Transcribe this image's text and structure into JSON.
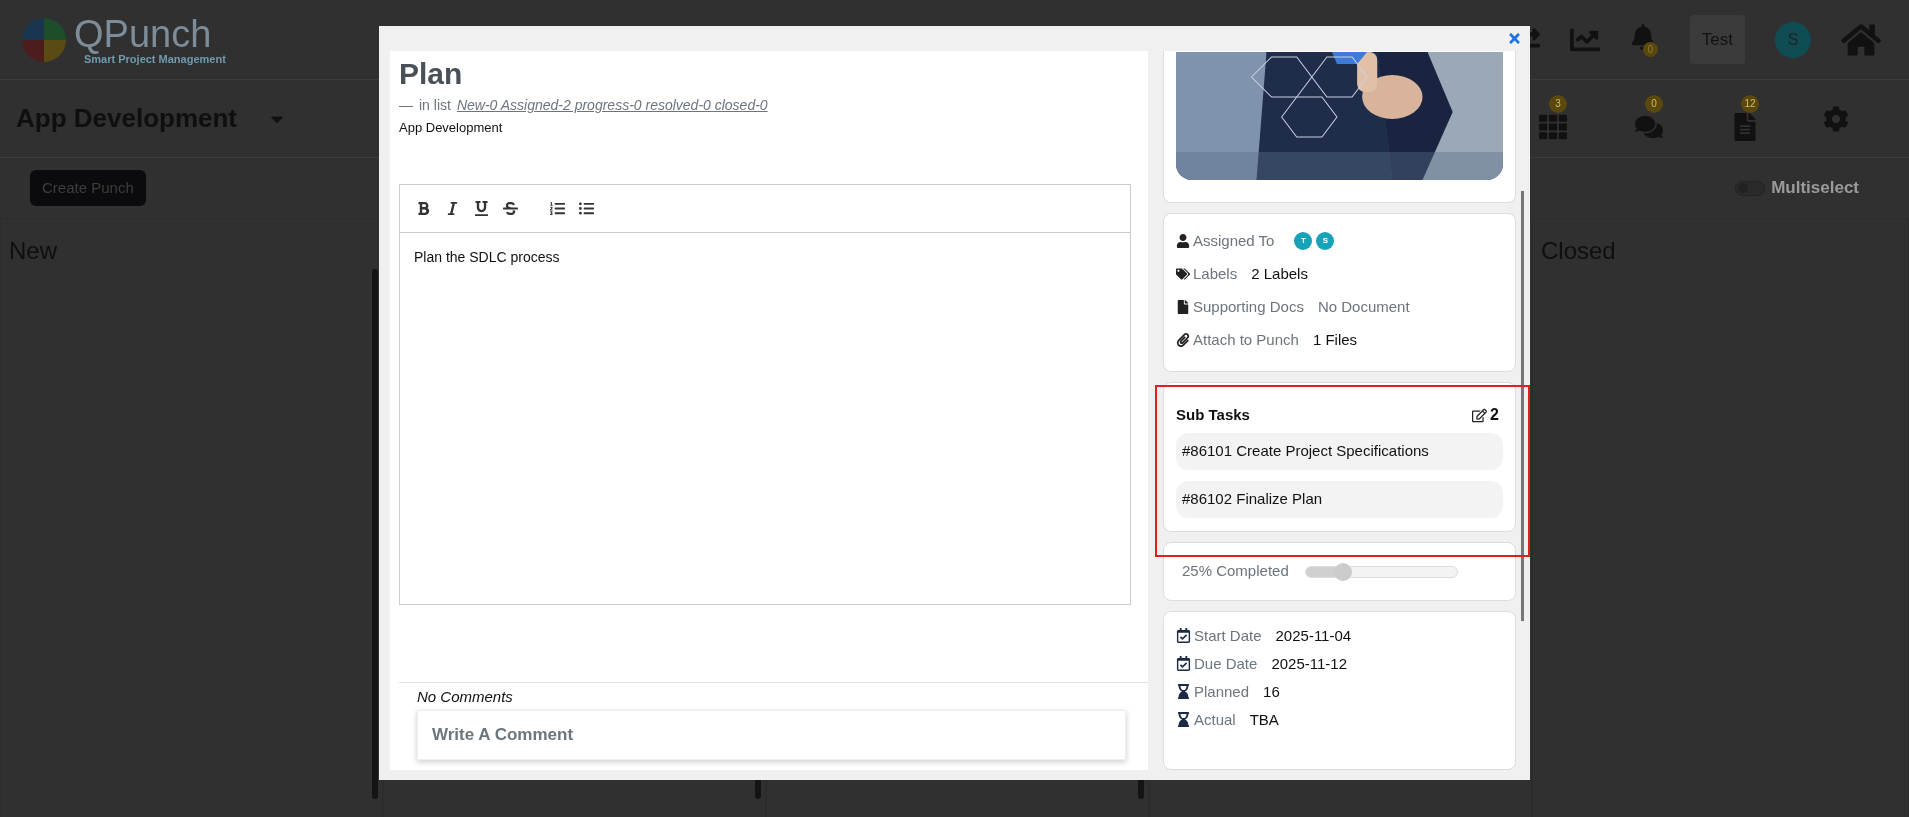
{
  "header": {
    "logo_title": "QPunch",
    "logo_subtitle": "Smart Project Management",
    "notification_count": "0",
    "user_label": "Test",
    "avatar": "S"
  },
  "project": {
    "name": "App Development",
    "badges": [
      {
        "kind": "grid",
        "count": "3"
      },
      {
        "kind": "chat",
        "count": "0"
      },
      {
        "kind": "document",
        "count": "12"
      }
    ]
  },
  "create_button": "Create Punch",
  "multiselect": {
    "label": "Multiselect",
    "on": false
  },
  "columns": [
    {
      "title": "New"
    },
    {
      "title": "Closed"
    }
  ],
  "modal": {
    "title": "Plan",
    "list_dash": "—",
    "list_prefix": "in list",
    "list_link": "New-0 Assigned-2 progress-0 resolved-0 closed-0",
    "project": "App Development",
    "editor": {
      "tools": [
        {
          "kind": "bold"
        },
        {
          "kind": "italic"
        },
        {
          "kind": "underline"
        },
        {
          "kind": "strike"
        },
        {
          "kind": "ordered-list"
        },
        {
          "kind": "bullet-list"
        }
      ],
      "content": "Plan the SDLC process"
    },
    "comments": {
      "empty_text": "No Comments",
      "placeholder": "Write A Comment"
    },
    "details": [
      {
        "kind": "assignees",
        "label": "Assigned To",
        "avatars": [
          "T",
          "S"
        ]
      },
      {
        "kind": "labels",
        "label": "Labels",
        "value": "2 Labels"
      },
      {
        "kind": "docs",
        "label": "Supporting Docs",
        "value": "No Document"
      },
      {
        "kind": "attachments",
        "label": "Attach to Punch",
        "value": "1 Files"
      }
    ],
    "subtasks": {
      "title": "Sub Tasks",
      "count": "2",
      "items": [
        "#86101 Create Project Specifications",
        "#86102 Finalize Plan"
      ]
    },
    "progress": {
      "label": "25% Completed",
      "level": 0.25
    },
    "dates": [
      {
        "kind": "calendar",
        "label": "Start Date",
        "value": "2025-11-04"
      },
      {
        "kind": "calendar",
        "label": "Due Date",
        "value": "2025-11-12"
      },
      {
        "kind": "hourglass",
        "label": "Planned",
        "value": "16"
      },
      {
        "kind": "hourglass",
        "label": "Actual",
        "value": "TBA"
      }
    ]
  }
}
